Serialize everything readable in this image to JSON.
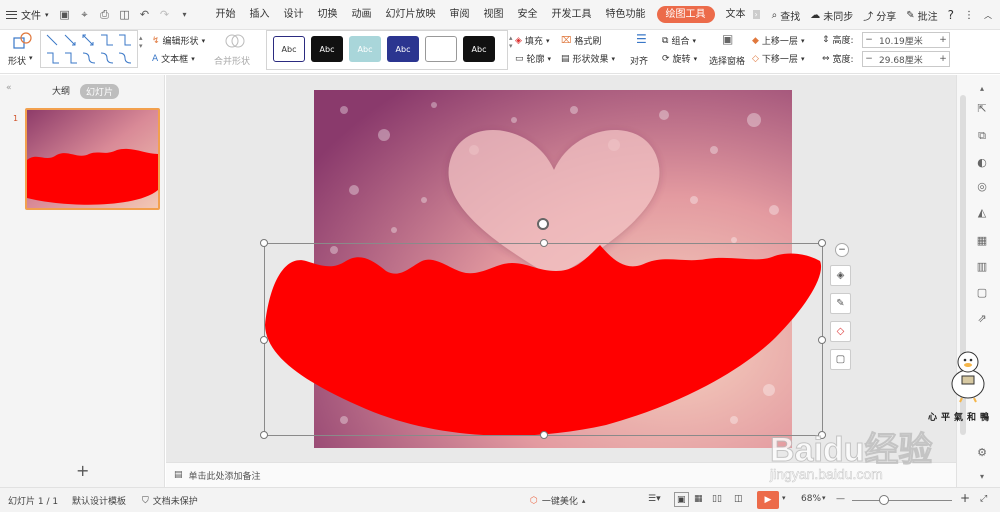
{
  "topbar": {
    "menu_label": "文件",
    "tabs": [
      "开始",
      "插入",
      "设计",
      "切换",
      "动画",
      "幻灯片放映",
      "审阅",
      "视图",
      "安全",
      "开发工具",
      "特色功能",
      "绘图工具",
      "文本"
    ],
    "active_tab": "绘图工具",
    "search_label": "查找",
    "sync_label": "未同步",
    "share_label": "分享",
    "comment_label": "批注",
    "help_label": "?"
  },
  "ribbon": {
    "shape_label": "形状",
    "edit_shape_label": "编辑形状",
    "textbox_label": "文本框",
    "merge_shape_label": "合并形状",
    "style_samples": [
      "Abc",
      "Abc",
      "Abc",
      "Abc",
      "",
      "Abc"
    ],
    "fill_label": "填充",
    "format_brush_label": "格式刷",
    "outline_label": "轮廓",
    "shape_effect_label": "形状效果",
    "align_label": "对齐",
    "group_label": "组合",
    "rotate_label": "旋转",
    "selection_pane_label": "选择窗格",
    "bring_forward_label": "上移一层",
    "send_backward_label": "下移一层",
    "height_label": "高度:",
    "height_value": "10.19厘米",
    "width_label": "宽度:",
    "width_value": "29.68厘米"
  },
  "leftpane": {
    "outline_tab": "大纲",
    "slides_tab": "幻灯片",
    "slide_number": "1",
    "add_label": "+"
  },
  "notes": {
    "placeholder": "单击此处添加备注"
  },
  "statusbar": {
    "slide_info": "幻灯片 1 / 1",
    "template": "默认设计模板",
    "protection": "文档未保护",
    "beautify": "一键美化",
    "zoom": "68%",
    "zoom_minus": "—",
    "zoom_plus": "+"
  },
  "watermark": {
    "caption": "心平氣和鴨",
    "brand": "Baidu经验",
    "url": "jingyan.baidu.com"
  },
  "colors": {
    "accent": "#ec6b4a",
    "shape_fill": "#ff0000",
    "selection_border": "#8a8a8a"
  }
}
